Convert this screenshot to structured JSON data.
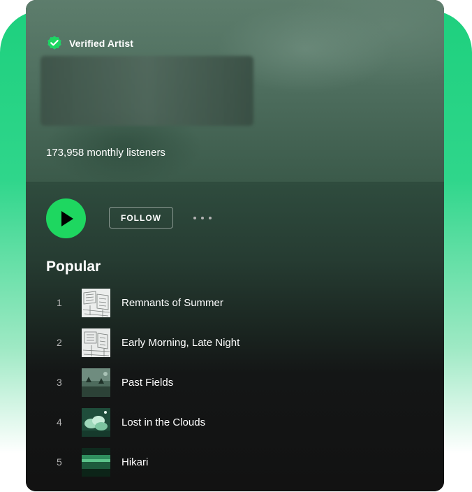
{
  "header": {
    "verified_label": "Verified Artist",
    "artist_name": "",
    "monthly_listeners": "173,958 monthly listeners"
  },
  "actions": {
    "follow_label": "FOLLOW"
  },
  "popular": {
    "title": "Popular",
    "tracks": [
      {
        "number": "1",
        "title": "Remnants of Summer",
        "art": "sketch-art"
      },
      {
        "number": "2",
        "title": "Early Morning, Late Night",
        "art": "sketch-art"
      },
      {
        "number": "3",
        "title": "Past Fields",
        "art": "green-field-art"
      },
      {
        "number": "4",
        "title": "Lost in the Clouds",
        "art": "green-clouds-art"
      },
      {
        "number": "5",
        "title": "Hikari",
        "art": "green-landscape-art"
      }
    ]
  },
  "colors": {
    "accent": "#1ed760",
    "background": "#121212",
    "backdrop": "#1ed07e"
  }
}
